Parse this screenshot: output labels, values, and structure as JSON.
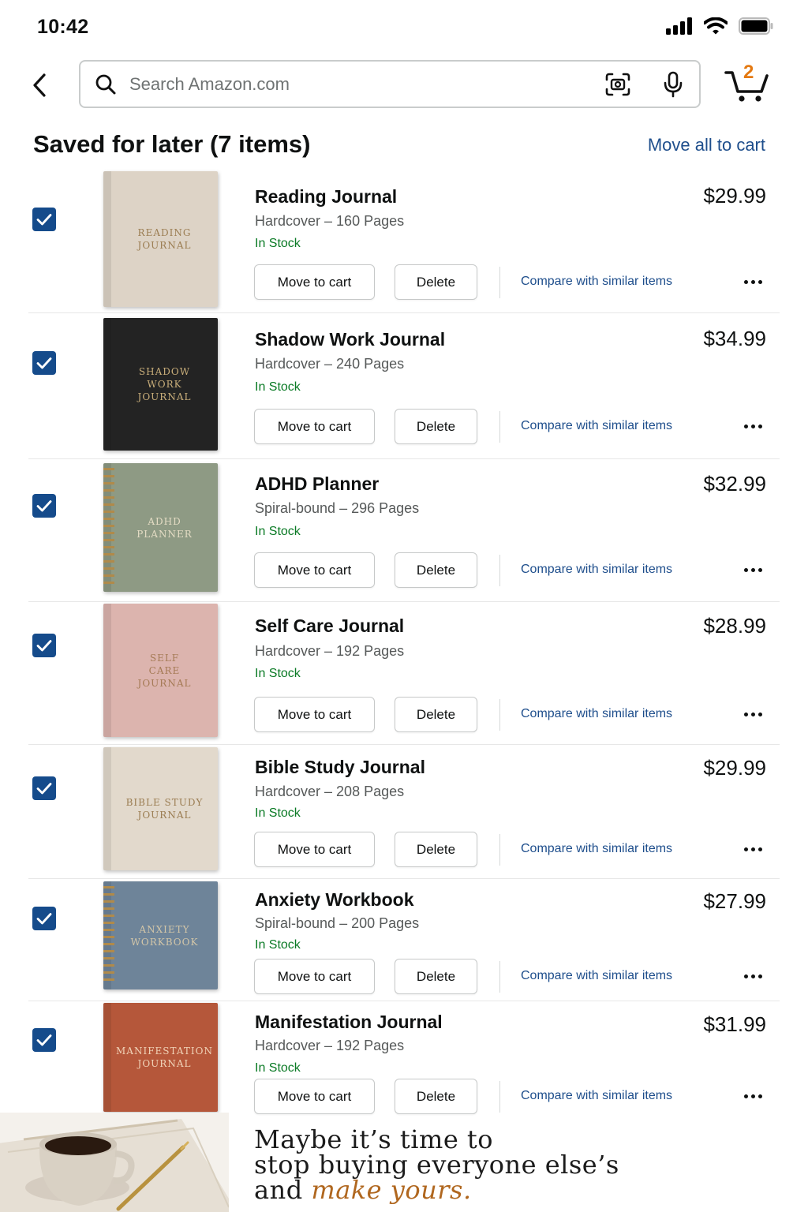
{
  "status_bar": {
    "time": "10:42"
  },
  "header": {
    "search_placeholder": "Search Amazon.com",
    "cart_count": "2"
  },
  "section": {
    "title": "Saved for later (7 items)",
    "move_all_label": "Move all to cart"
  },
  "actions": {
    "move_to_cart": "Move to cart",
    "delete": "Delete",
    "compare": "Compare with similar items"
  },
  "items": [
    {
      "title": "Reading Journal",
      "format": "Hardcover – 160 Pages",
      "stock": "In Stock",
      "price": "$29.99",
      "cover_text": "READING\nJOURNAL",
      "cover_color": "#ddd3c6",
      "cover_text_color": "#9b7d52",
      "binding": "hardcover",
      "checked": true
    },
    {
      "title": "Shadow Work Journal",
      "format": "Hardcover – 240 Pages",
      "stock": "In Stock",
      "price": "$34.99",
      "cover_text": "SHADOW\nWORK\nJOURNAL",
      "cover_color": "#232323",
      "cover_text_color": "#c9ae7a",
      "binding": "hardcover",
      "checked": true
    },
    {
      "title": "ADHD Planner",
      "format": "Spiral-bound – 296 Pages",
      "stock": "In Stock",
      "price": "$32.99",
      "cover_text": "ADHD\nPLANNER",
      "cover_color": "#8e9a84",
      "cover_text_color": "#e4dcc4",
      "binding": "spiral",
      "checked": true
    },
    {
      "title": "Self Care Journal",
      "format": "Hardcover – 192 Pages",
      "stock": "In Stock",
      "price": "$28.99",
      "cover_text": "SELF\nCARE\nJOURNAL",
      "cover_color": "#dcb4ae",
      "cover_text_color": "#a57a55",
      "binding": "hardcover",
      "checked": true
    },
    {
      "title": "Bible Study Journal",
      "format": "Hardcover – 208 Pages",
      "stock": "In Stock",
      "price": "$29.99",
      "cover_text": "BIBLE STUDY\nJOURNAL",
      "cover_color": "#e2d9cc",
      "cover_text_color": "#9b7d52",
      "binding": "hardcover",
      "checked": true
    },
    {
      "title": "Anxiety Workbook",
      "format": "Spiral-bound – 200 Pages",
      "stock": "In Stock",
      "price": "$27.99",
      "cover_text": "ANXIETY\nWORKBOOK",
      "cover_color": "#6e8499",
      "cover_text_color": "#d3c6a8",
      "binding": "spiral",
      "checked": true
    },
    {
      "title": "Manifestation Journal",
      "format": "Hardcover – 192 Pages",
      "stock": "In Stock",
      "price": "$31.99",
      "cover_text": "MANIFESTATION\nJOURNAL",
      "cover_color": "#b5573a",
      "cover_text_color": "#f0d3b8",
      "binding": "hardcover",
      "checked": true
    }
  ],
  "promo": {
    "line1": "Maybe it’s time to",
    "line2": "stop buying everyone else’s",
    "line3_prefix": "and ",
    "line3_accent": "make yours."
  }
}
